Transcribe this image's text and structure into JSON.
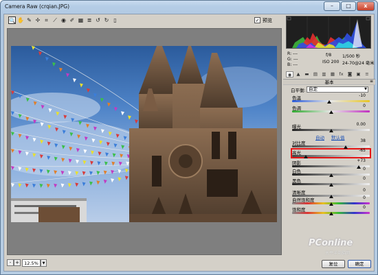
{
  "window": {
    "title": "Camera Raw (crqian.JPG)",
    "min_label": "–",
    "max_label": "□",
    "close_label": "x"
  },
  "toolbar": {
    "tools": [
      {
        "name": "zoom-icon",
        "glyph": "🔍"
      },
      {
        "name": "hand-icon",
        "glyph": "✋"
      },
      {
        "name": "white-balance-icon",
        "glyph": "✎"
      },
      {
        "name": "color-sampler-icon",
        "glyph": "✢"
      },
      {
        "name": "crop-icon",
        "glyph": "⌗"
      },
      {
        "name": "straighten-icon",
        "glyph": "⟋"
      },
      {
        "name": "red-eye-icon",
        "glyph": "◉"
      },
      {
        "name": "brush-icon",
        "glyph": "✐"
      },
      {
        "name": "gradient-icon",
        "glyph": "▦"
      },
      {
        "name": "settings-icon",
        "glyph": "≣"
      },
      {
        "name": "rotate-ccw-icon",
        "glyph": "↺"
      },
      {
        "name": "rotate-cw-icon",
        "glyph": "↻"
      },
      {
        "name": "trash-icon",
        "glyph": "▯"
      }
    ],
    "preview_check": "✓",
    "preview_label": "预览"
  },
  "status": {
    "zoom": "12.5%",
    "minus": "-",
    "plus": "+",
    "dropdown": "▼"
  },
  "readout": {
    "r": "R: ---",
    "g": "G: ---",
    "b": "B: ---",
    "aperture": "f/8",
    "shutter": "1/500 秒",
    "iso": "ISO 200",
    "lens": "24-70@24 毫米"
  },
  "tabs": [
    "◉",
    "▲",
    "▬",
    "▤",
    "▥",
    "▦",
    "fx",
    "◙",
    "▣",
    "≡"
  ],
  "panel": {
    "title": "基本",
    "menu": "≡",
    "wb_label": "白平衡:",
    "wb_value": "自定",
    "auto_link": "自动",
    "default_link": "默认值",
    "rows": [
      {
        "name": "temperature",
        "label": "色温",
        "value": "-10",
        "pos": 0.48,
        "track": "linear-gradient(90deg,#2a5bd8,#e8e8e8,#e7c523)"
      },
      {
        "name": "tint",
        "label": "色调",
        "value": "0",
        "pos": 0.5,
        "track": "linear-gradient(90deg,#2fa82f,#e8e8e8,#c02fc0)"
      },
      {
        "name": "exposure",
        "label": "曝光",
        "value": "0.00",
        "pos": 0.5,
        "track": "linear-gradient(90deg,#222,#f0f0f0)"
      },
      {
        "name": "contrast",
        "label": "对比度",
        "value": "38",
        "pos": 0.69,
        "track": "linear-gradient(90deg,#444,#f0f0f0)"
      },
      {
        "name": "highlights",
        "label": "高光",
        "value": "-65",
        "pos": 0.18,
        "track": "linear-gradient(90deg,#444,#f0f0f0)"
      },
      {
        "name": "shadows",
        "label": "阴影",
        "value": "+73",
        "pos": 0.86,
        "track": "linear-gradient(90deg,#222,#f0f0f0)"
      },
      {
        "name": "whites",
        "label": "白色",
        "value": "0",
        "pos": 0.5,
        "track": "linear-gradient(90deg,#222,#f0f0f0)"
      },
      {
        "name": "blacks",
        "label": "黑色",
        "value": "0",
        "pos": 0.5,
        "track": "linear-gradient(90deg,#222,#f0f0f0)"
      },
      {
        "name": "clarity",
        "label": "清晰度",
        "value": "0",
        "pos": 0.5,
        "track": "linear-gradient(90deg,#555,#f0f0f0)"
      },
      {
        "name": "vibrance",
        "label": "自然饱和度",
        "value": "0",
        "pos": 0.5,
        "track": "linear-gradient(90deg,#888,#d33,#e8c020,#3b3,#33c,#c3c)"
      },
      {
        "name": "saturation",
        "label": "饱和度",
        "value": "0",
        "pos": 0.5,
        "track": "linear-gradient(90deg,#888,#d33,#e8c020,#3b3,#33c,#c3c)"
      }
    ]
  },
  "buttons": {
    "reset": "复位",
    "ok": "确定"
  },
  "watermark": {
    "brand": "PConline",
    "sub": "太平洋电脑网"
  }
}
